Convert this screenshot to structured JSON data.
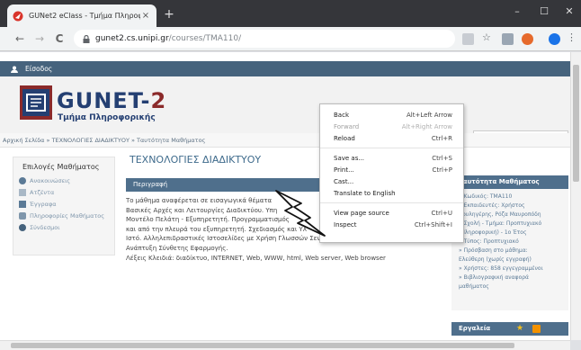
{
  "browser": {
    "tab_title": "GUNet2 eClass - Τμήμα Πληροφο",
    "new_tab": "+",
    "url_host": "gunet2.cs.unipi.gr",
    "url_path": "/courses/TMA110/",
    "window_controls": [
      "–",
      "☐",
      "✕"
    ],
    "nav": {
      "back": "←",
      "forward": "→",
      "reload": "C"
    }
  },
  "page": {
    "login_label": "Είσοδος",
    "logo_text": "GUNET-",
    "logo_two": "2",
    "logo_subtitle": "Τμήμα Πληροφορικής",
    "breadcrumb": "Αρχική Σελίδα » ΤΕΧΝΟΛΟΓΙΕΣ ΔΙΑΔΙΚΤΥΟΥ » Ταυτότητα Μαθήματος",
    "left_panel": {
      "title": "Επιλογές Μαθήματος",
      "items": [
        "Ανακοινώσεις",
        "Ατζέντα",
        "Έγγραφα",
        "Πληροφορίες Μαθήματος",
        "Σύνδεσμοι"
      ]
    },
    "course_title": "ΤΕΧΝΟΛΟΓΙΕΣ ΔΙΑΔΙΚΤΥΟΥ",
    "description_header": "Περιγραφή",
    "description_lines": [
      "Το μάθημα αναφέρεται σε εισαγωγικά θέματα",
      "Βασικές Αρχές και Λειτουργίες Διαδικτύου. Υπη",
      "Μοντέλο Πελάτη - Εξυπηρετητή. Προγραμματισμός",
      "και από την πλευρά του εξυπηρετητή. Σχεδιασμός και Υλ",
      "Ιστό. Αλληλεπιδραστικές Ιστοσελίδες με Χρήση Γλωσσών Σεναρίων (scripting languages).",
      "Ανάπτυξη Σύνθετης Εφαρμογής.",
      "Λέξεις Κλειδιά: διαδίκτυο, INTERNET, Web, WWW, html, Web server, Web browser"
    ],
    "right_panel": {
      "header": "Ταυτότητα Μαθήματος",
      "lines": [
        "» Κωδικός: TMA110",
        "» Εκπαιδευτές: Χρήστος",
        "Δουληγέρης, Ρόζα Μαυροπόδη",
        "» Σχολή - Τμήμα: Προπτυχιακό",
        "(Πληροφορική) - 1ο Έτος",
        "» Τύπος: Προπτυχιακό",
        "» Πρόσβαση στο μάθημα:",
        "Ελεύθερη (χωρίς εγγραφή)",
        "» Χρήστες: 858 εγγεγραμμένοι",
        "» Βιβλιογραφική αναφορά",
        "μαθήματος"
      ]
    },
    "tools_header": "Εργαλεία"
  },
  "context_menu": {
    "groups": [
      [
        {
          "label": "Back",
          "shortcut": "Alt+Left Arrow",
          "disabled": false
        },
        {
          "label": "Forward",
          "shortcut": "Alt+Right Arrow",
          "disabled": true
        },
        {
          "label": "Reload",
          "shortcut": "Ctrl+R",
          "disabled": false
        }
      ],
      [
        {
          "label": "Save as...",
          "shortcut": "Ctrl+S",
          "disabled": false
        },
        {
          "label": "Print...",
          "shortcut": "Ctrl+P",
          "disabled": false
        },
        {
          "label": "Cast...",
          "shortcut": "",
          "disabled": false
        },
        {
          "label": "Translate to English",
          "shortcut": "",
          "disabled": false
        }
      ],
      [
        {
          "label": "View page source",
          "shortcut": "Ctrl+U",
          "disabled": false
        },
        {
          "label": "Inspect",
          "shortcut": "Ctrl+Shift+I",
          "disabled": false
        }
      ]
    ]
  },
  "colors": {
    "brand_blue": "#243f72",
    "brand_red": "#8b2a2a",
    "panel_header": "#4f6f8c",
    "link": "#7f96ab"
  },
  "icons": [
    "chrome-favicon",
    "lock-icon",
    "translate-icon",
    "star-icon",
    "extension-icon",
    "profile-icon",
    "menu-icon",
    "user-icon",
    "rss-icon"
  ]
}
